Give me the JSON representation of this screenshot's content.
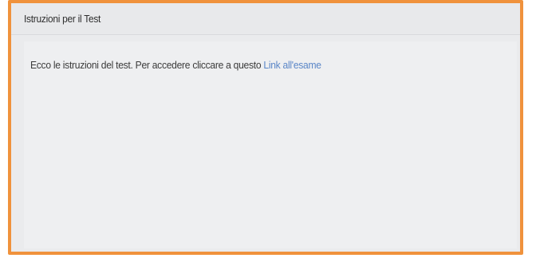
{
  "panel": {
    "title": "Istruzioni per il Test",
    "body_text": "Ecco le istruzioni del test. Per accedere cliccare a questo ",
    "link_label": "Link all'esame"
  },
  "colors": {
    "highlight_border": "#f0923c",
    "link": "#5a86c7",
    "panel_background": "#eaebed"
  }
}
